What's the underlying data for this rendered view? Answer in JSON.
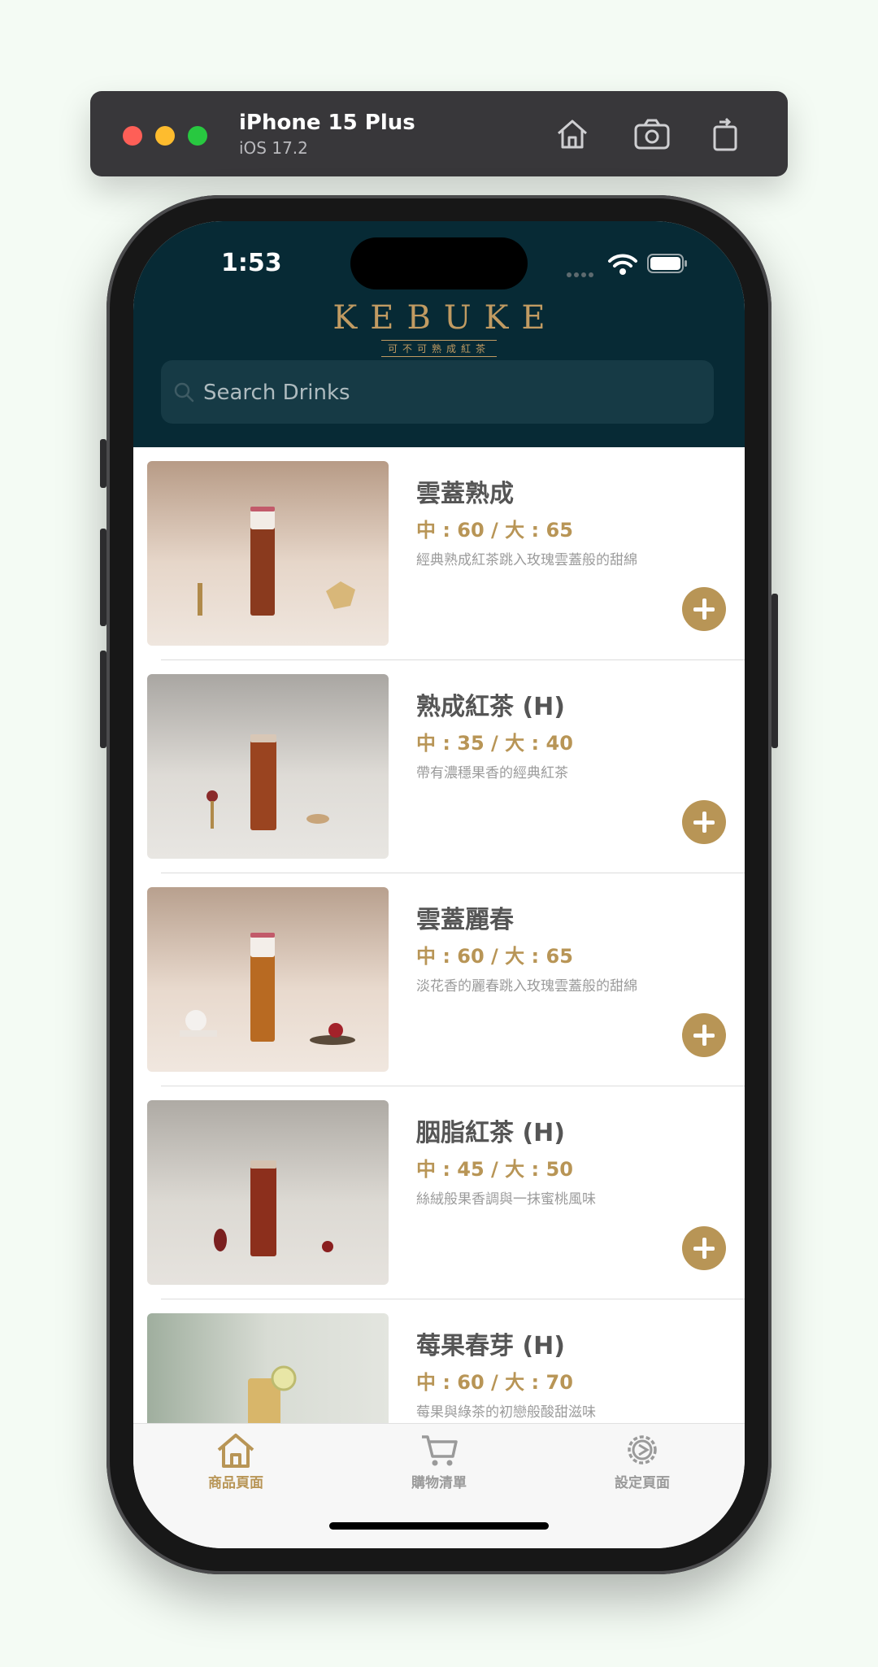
{
  "simulator": {
    "device": "iPhone 15 Plus",
    "os": "iOS 17.2",
    "icons": [
      "home-icon",
      "screenshot-icon",
      "rotate-icon"
    ]
  },
  "status_bar": {
    "time": "1:53"
  },
  "header": {
    "logo": "KEBUKE",
    "logo_tagline": "可不可熟成紅茶",
    "background": "#072a35",
    "accent": "#c19b62"
  },
  "search": {
    "placeholder": "Search Drinks",
    "value": ""
  },
  "products": [
    {
      "name": "雲蓋熟成",
      "price": "中 : 60 / 大 : 65",
      "desc": "經典熟成紅茶跳入玫瑰雲蓋般的甜綿"
    },
    {
      "name": "熟成紅茶 (H)",
      "price": "中 : 35 / 大 : 40",
      "desc": "帶有濃穩果香的經典紅茶"
    },
    {
      "name": "雲蓋麗春",
      "price": "中 : 60 / 大 : 65",
      "desc": "淡花香的麗春跳入玫瑰雲蓋般的甜綿"
    },
    {
      "name": "胭脂紅茶 (H)",
      "price": "中 : 45 / 大 : 50",
      "desc": "絲絨般果香調與一抹蜜桃風味"
    },
    {
      "name": "莓果春芽 (H)",
      "price": "中 : 60 / 大 : 70",
      "desc": "莓果與綠茶的初戀般酸甜滋味"
    }
  ],
  "tabs": [
    {
      "label": "商品頁面",
      "icon": "house-icon",
      "active": true
    },
    {
      "label": "購物清單",
      "icon": "cart-icon",
      "active": false
    },
    {
      "label": "設定頁面",
      "icon": "gear-icon",
      "active": false
    }
  ],
  "colors": {
    "price": "#b89556",
    "add_button": "#b89556",
    "tab_active": "#b89556",
    "tab_inactive": "#9a9a9a"
  }
}
